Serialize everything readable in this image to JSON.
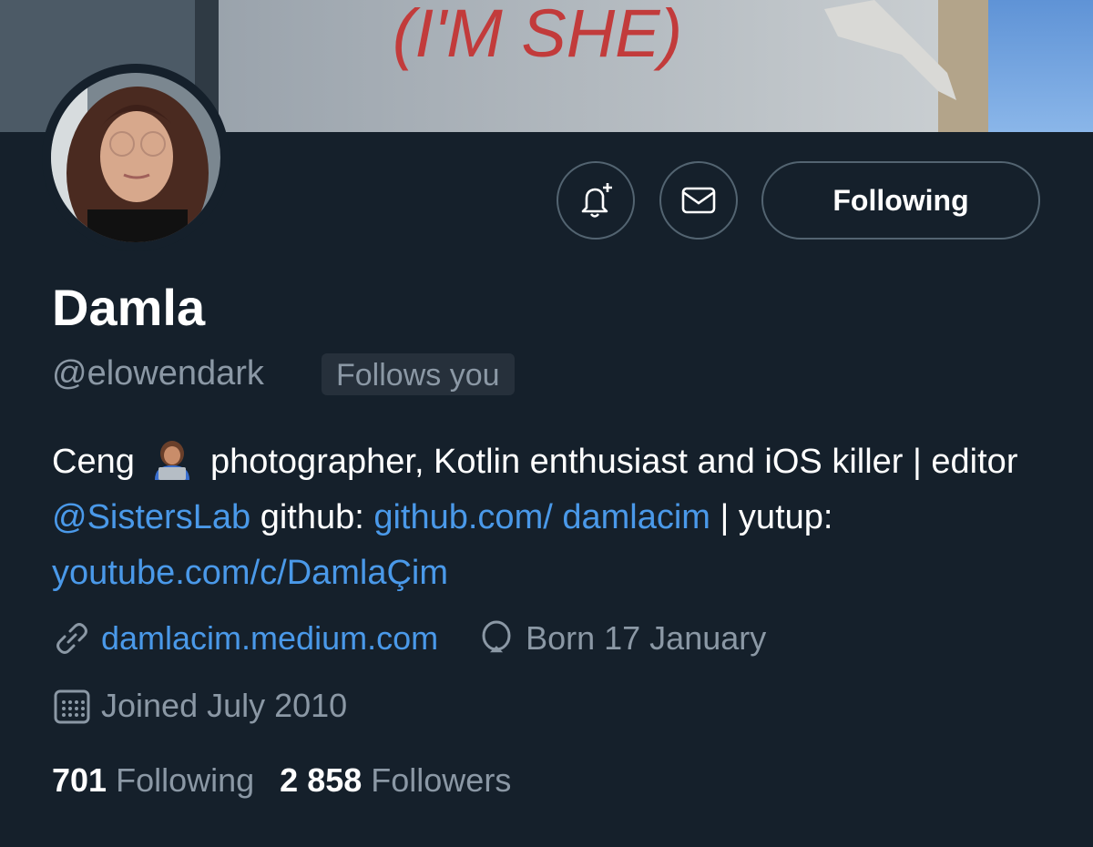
{
  "profile": {
    "name": "Damla",
    "handle": "@elowendark",
    "follows_you_badge": "Follows you",
    "follow_button_label": "Following",
    "bio": {
      "part1": "Ceng",
      "part2": "photographer, Kotlin enthusiast and iOS killer | editor",
      "mention": "@SistersLab",
      "part3": "github:",
      "github_link": "github.com/ damlacim",
      "part4": "| yutup:",
      "youtube_link": "youtube.com/c/DamlaÇim"
    },
    "website": "damlacim.medium.com",
    "birthday": "Born 17 January",
    "joined": "Joined July 2010",
    "following_count": "701",
    "following_label": "Following",
    "followers_count": "2 858",
    "followers_label": "Followers"
  },
  "banner": {
    "text": "(I'M SHE)"
  },
  "icons": {
    "notify": "bell-plus-icon",
    "message": "envelope-icon",
    "website": "link-icon",
    "birthday": "balloon-icon",
    "joined": "calendar-icon",
    "bio_emoji": "woman-technologist-emoji"
  },
  "colors": {
    "background": "#15202b",
    "link": "#4a99e9",
    "secondary_text": "#8b98a5",
    "border": "#536471"
  }
}
